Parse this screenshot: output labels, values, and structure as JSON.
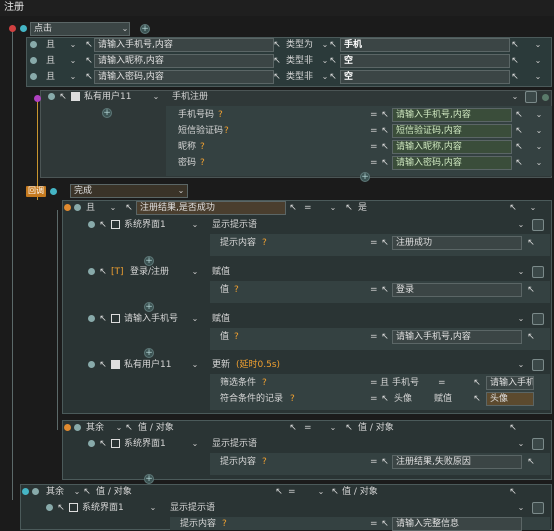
{
  "window": {
    "title": "注册"
  },
  "trigger": {
    "label": "点击"
  },
  "conditions": [
    {
      "join": "且",
      "input": "请输入手机号,内容",
      "op": "类型为",
      "value": "手机"
    },
    {
      "join": "且",
      "input": "请输入昵称,内容",
      "op": "类型非",
      "value": "空"
    },
    {
      "join": "且",
      "input": "请输入密码,内容",
      "op": "类型非",
      "value": "空"
    }
  ],
  "register_action": {
    "target": "私有用户11",
    "action": "手机注册",
    "params": [
      {
        "label": "手机号码",
        "value": "请输入手机号,内容"
      },
      {
        "label": "短信验证码",
        "value": "短信验证码,内容"
      },
      {
        "label": "昵称",
        "value": "请输入昵称,内容"
      },
      {
        "label": "密码",
        "value": "请输入密码,内容"
      }
    ]
  },
  "callback": {
    "badge": "回调",
    "event": "完成"
  },
  "success_branch": {
    "join": "且",
    "input": "注册结果,是否成功",
    "op": "=",
    "value": "是",
    "actions": [
      {
        "target": "系统界面1",
        "action": "显示提示语",
        "param_label": "提示内容",
        "param_value": "注册成功"
      },
      {
        "target": "登录/注册",
        "action": "赋值",
        "param_label": "值",
        "param_value": "登录"
      },
      {
        "target": "请输入手机号",
        "action": "赋值",
        "param_label": "值",
        "param_value": "请输入手机号,内容"
      },
      {
        "target": "私有用户11",
        "action": "更新",
        "delay": "(延时0.5s)",
        "filter_label": "筛选条件",
        "filter_join": "且",
        "filter_field": "手机号",
        "filter_op": "=",
        "filter_value": "请输入手机号",
        "record_label": "符合条件的记录",
        "record_field": "头像",
        "record_op": "赋值",
        "record_value": "头像"
      }
    ]
  },
  "else_branch": {
    "join": "其余",
    "input": "值 / 对象",
    "op": "=",
    "value": "值 / 对象",
    "action": {
      "target": "系统界面1",
      "action": "显示提示语",
      "param_label": "提示内容",
      "param_value": "注册结果,失败原因"
    }
  },
  "outer_else": {
    "join": "其余",
    "input": "值 / 对象",
    "op": "=",
    "value": "值 / 对象",
    "action": {
      "target": "系统界面1",
      "action": "显示提示语",
      "param_label": "提示内容",
      "param_value": "请输入完整信息"
    }
  }
}
